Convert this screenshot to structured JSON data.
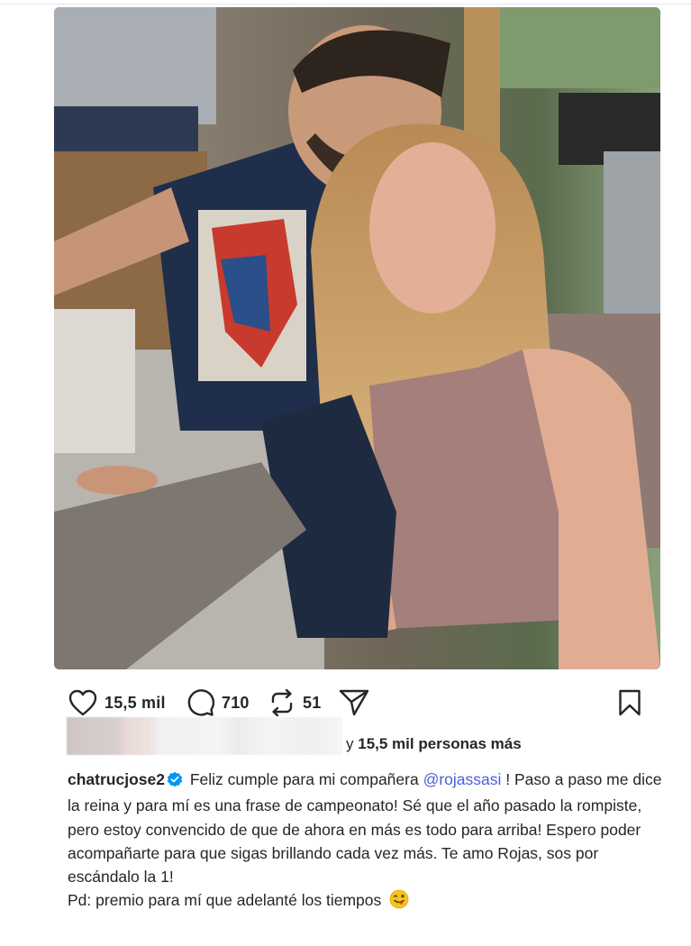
{
  "post": {
    "image_icon": "selfie-photo",
    "actions": {
      "like_icon": "heart-icon",
      "like_count": "15,5 mil",
      "comment_icon": "comment-bubble-icon",
      "comment_count": "710",
      "repost_icon": "repost-icon",
      "repost_count": "51",
      "share_icon": "send-icon",
      "save_icon": "bookmark-icon"
    },
    "likes": {
      "connector": "y",
      "others": "15,5 mil personas más"
    },
    "caption": {
      "username": "chatrucjose2",
      "verified_icon": "verified-badge-icon",
      "text_before_mention": "Feliz cumple para mi compañera",
      "mention": "@rojassasi",
      "text_after_mention": "! Paso a paso me dice la reina y para mí es una frase de campeonato! Sé que el año pasado la rompiste, pero estoy convencido de que de ahora en más es todo para arriba! Espero poder acompañarte para que sigas brillando cada vez más. Te amo Rojas, sos por escándalo la 1!",
      "ps": "Pd: premio para mí que adelanté los tiempos",
      "emoji_icon": "winking-tongue-emoji"
    },
    "colors": {
      "text": "#262626",
      "mention": "#4a5fd8",
      "verified": "#0095f6"
    }
  }
}
